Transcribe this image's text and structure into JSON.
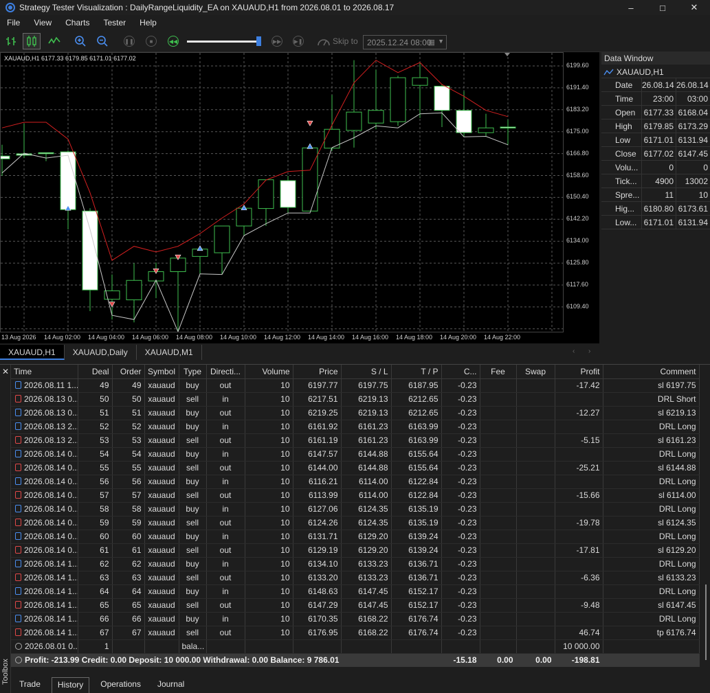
{
  "window": {
    "title": "Strategy Tester Visualization : DailyRangeLiquidity_EA on XAUAUD,H1 from 2026.08.01 to 2026.08.17"
  },
  "menu": [
    "File",
    "View",
    "Charts",
    "Tester",
    "Help"
  ],
  "toolbar": {
    "skip_label": "Skip to",
    "skip_date": "2025.12.24 08:00",
    "speed_fraction": 0.95
  },
  "chart": {
    "info": "XAUAUD,H1  6177.33 6179.85 6171.01 6177.02",
    "price_labels": [
      "6199.60",
      "6191.40",
      "6183.20",
      "6175.00",
      "6166.80",
      "6158.60",
      "6150.40",
      "6142.20",
      "6134.00",
      "6125.80",
      "6117.60",
      "6109.40"
    ],
    "time_labels": [
      "13 Aug 2026",
      "14 Aug 02:00",
      "14 Aug 04:00",
      "14 Aug 06:00",
      "14 Aug 08:00",
      "14 Aug 10:00",
      "14 Aug 12:00",
      "14 Aug 14:00",
      "14 Aug 16:00",
      "14 Aug 18:00",
      "14 Aug 20:00",
      "14 Aug 22:00"
    ],
    "tabs": [
      "XAUAUD,H1",
      "XAUAUD,Daily",
      "XAUAUD,M1"
    ],
    "active_tab": 0
  },
  "chart_data": {
    "type": "candlestick",
    "ylim": [
      6104.2,
      6203.6
    ],
    "candles": [
      {
        "o": 6167.0,
        "h": 6171.0,
        "l": 6160.0,
        "c": 6166.0
      },
      {
        "o": 6167.8,
        "h": 6178.5,
        "l": 6166.3,
        "c": 6167.3
      },
      {
        "o": 6168.2,
        "h": 6168.2,
        "l": 6165.2,
        "c": 6168.0
      },
      {
        "o": 6168.5,
        "h": 6169.0,
        "l": 6141.0,
        "c": 6148.0
      },
      {
        "o": 6147.5,
        "h": 6148.5,
        "l": 6112.0,
        "c": 6119.5
      },
      {
        "o": 6116.2,
        "h": 6125.0,
        "l": 6109.0,
        "c": 6119.2
      },
      {
        "o": 6116.0,
        "h": 6129.0,
        "l": 6108.0,
        "c": 6122.9
      },
      {
        "o": 6122.7,
        "h": 6129.2,
        "l": 6116.6,
        "c": 6126.0
      },
      {
        "o": 6126.0,
        "h": 6131.4,
        "l": 6104.7,
        "c": 6130.8
      },
      {
        "o": 6131.4,
        "h": 6134.2,
        "l": 6125.0,
        "c": 6134.0
      },
      {
        "o": 6132.7,
        "h": 6142.2,
        "l": 6125.0,
        "c": 6142.2
      },
      {
        "o": 6142.2,
        "h": 6148.5,
        "l": 6138.8,
        "c": 6148.5
      },
      {
        "o": 6148.4,
        "h": 6158.6,
        "l": 6142.2,
        "c": 6158.6
      },
      {
        "o": 6158.3,
        "h": 6160.0,
        "l": 6146.8,
        "c": 6148.8
      },
      {
        "o": 6147.5,
        "h": 6170.3,
        "l": 6147.5,
        "c": 6169.9
      },
      {
        "o": 6169.8,
        "h": 6188.7,
        "l": 6168.8,
        "c": 6176.5
      },
      {
        "o": 6176.1,
        "h": 6201.0,
        "l": 6170.0,
        "c": 6182.6
      },
      {
        "o": 6178.7,
        "h": 6197.6,
        "l": 6176.5,
        "c": 6183.2
      },
      {
        "o": 6179.2,
        "h": 6195.5,
        "l": 6177.7,
        "c": 6194.8
      },
      {
        "o": 6192.1,
        "h": 6200.0,
        "l": 6180.5,
        "c": 6194.8
      },
      {
        "o": 6191.8,
        "h": 6192.5,
        "l": 6177.3,
        "c": 6183.2
      },
      {
        "o": 6183.2,
        "h": 6190.0,
        "l": 6173.8,
        "c": 6175.3
      },
      {
        "o": 6175.3,
        "h": 6182.0,
        "l": 6174.0,
        "c": 6177.0
      },
      {
        "o": 6177.3,
        "h": 6179.9,
        "l": 6171.0,
        "c": 6177.0
      }
    ],
    "upper_line": [
      6177.0,
      6179.0,
      6179.0,
      6173.0,
      6154.0,
      6130.0,
      6135.0,
      6133.0,
      6135.0,
      6139.5,
      6145.0,
      6150.0,
      6158.5,
      6161.5,
      6162.0,
      6178.0,
      6193.0,
      6201.0,
      6196.6,
      6200.2,
      6192.4,
      6188.2,
      6183.2,
      6181.0
    ],
    "lower_line": [
      6161.0,
      6168.0,
      6166.3,
      6167.3,
      6141.0,
      6110.5,
      6109.0,
      6123.0,
      6104.7,
      6125.2,
      6125.0,
      6138.8,
      6143.0,
      6146.8,
      6146.8,
      6170.0,
      6173.5,
      6177.7,
      6177.0,
      6182.0,
      6182.3,
      6173.8,
      6174.0,
      6171.0
    ],
    "markers": [
      {
        "i": 3,
        "price": 6148.5,
        "dir": "buy"
      },
      {
        "i": 5,
        "price": 6114.5,
        "dir": "sell"
      },
      {
        "i": 7,
        "price": 6126.3,
        "dir": "sell"
      },
      {
        "i": 8,
        "price": 6131.2,
        "dir": "sell"
      },
      {
        "i": 9,
        "price": 6134.2,
        "dir": "buy"
      },
      {
        "i": 11,
        "price": 6148.6,
        "dir": "buy"
      },
      {
        "i": 14,
        "price": 6178.7,
        "dir": "sell"
      },
      {
        "i": 14,
        "price": 6170.4,
        "dir": "buy"
      }
    ]
  },
  "data_window": {
    "title": "Data Window",
    "symbol": "XAUAUD,H1",
    "rows": [
      {
        "k": "Date",
        "v1": "26.08.14",
        "v2": "26.08.14"
      },
      {
        "k": "Time",
        "v1": "23:00",
        "v2": "03:00"
      },
      {
        "k": "Open",
        "v1": "6177.33",
        "v2": "6168.04"
      },
      {
        "k": "High",
        "v1": "6179.85",
        "v2": "6173.29"
      },
      {
        "k": "Low",
        "v1": "6171.01",
        "v2": "6131.94"
      },
      {
        "k": "Close",
        "v1": "6177.02",
        "v2": "6147.45"
      },
      {
        "k": "Volu...",
        "v1": "0",
        "v2": "0"
      },
      {
        "k": "Tick...",
        "v1": "4900",
        "v2": "13002"
      },
      {
        "k": "Spre...",
        "v1": "11",
        "v2": "10"
      },
      {
        "k": "Hig...",
        "v1": "6180.80",
        "v2": "6173.61"
      },
      {
        "k": "Low...",
        "v1": "6171.01",
        "v2": "6131.94"
      }
    ]
  },
  "deals": {
    "columns": [
      "Time",
      "Deal",
      "Order",
      "Symbol",
      "Type",
      "Directi...",
      "Volume",
      "Price",
      "S / L",
      "T / P",
      "C...",
      "Fee",
      "Swap",
      "Profit",
      "Comment"
    ],
    "rows": [
      {
        "side": "buy",
        "time": "2026.08.11 1...",
        "deal": "49",
        "order": "49",
        "symbol": "xauaud",
        "type": "buy",
        "dir": "out",
        "vol": "10",
        "price": "6197.77",
        "sl": "6197.75",
        "tp": "6187.95",
        "comm": "-0.23",
        "fee": "",
        "swap": "",
        "profit": "-17.42",
        "comment": "sl 6197.75"
      },
      {
        "side": "sell",
        "time": "2026.08.13 0...",
        "deal": "50",
        "order": "50",
        "symbol": "xauaud",
        "type": "sell",
        "dir": "in",
        "vol": "10",
        "price": "6217.51",
        "sl": "6219.13",
        "tp": "6212.65",
        "comm": "-0.23",
        "fee": "",
        "swap": "",
        "profit": "",
        "comment": "DRL Short"
      },
      {
        "side": "buy",
        "time": "2026.08.13 0...",
        "deal": "51",
        "order": "51",
        "symbol": "xauaud",
        "type": "buy",
        "dir": "out",
        "vol": "10",
        "price": "6219.25",
        "sl": "6219.13",
        "tp": "6212.65",
        "comm": "-0.23",
        "fee": "",
        "swap": "",
        "profit": "-12.27",
        "comment": "sl 6219.13"
      },
      {
        "side": "buy",
        "time": "2026.08.13 2...",
        "deal": "52",
        "order": "52",
        "symbol": "xauaud",
        "type": "buy",
        "dir": "in",
        "vol": "10",
        "price": "6161.92",
        "sl": "6161.23",
        "tp": "6163.99",
        "comm": "-0.23",
        "fee": "",
        "swap": "",
        "profit": "",
        "comment": "DRL Long"
      },
      {
        "side": "sell",
        "time": "2026.08.13 2...",
        "deal": "53",
        "order": "53",
        "symbol": "xauaud",
        "type": "sell",
        "dir": "out",
        "vol": "10",
        "price": "6161.19",
        "sl": "6161.23",
        "tp": "6163.99",
        "comm": "-0.23",
        "fee": "",
        "swap": "",
        "profit": "-5.15",
        "comment": "sl 6161.23"
      },
      {
        "side": "buy",
        "time": "2026.08.14 0...",
        "deal": "54",
        "order": "54",
        "symbol": "xauaud",
        "type": "buy",
        "dir": "in",
        "vol": "10",
        "price": "6147.57",
        "sl": "6144.88",
        "tp": "6155.64",
        "comm": "-0.23",
        "fee": "",
        "swap": "",
        "profit": "",
        "comment": "DRL Long"
      },
      {
        "side": "sell",
        "time": "2026.08.14 0...",
        "deal": "55",
        "order": "55",
        "symbol": "xauaud",
        "type": "sell",
        "dir": "out",
        "vol": "10",
        "price": "6144.00",
        "sl": "6144.88",
        "tp": "6155.64",
        "comm": "-0.23",
        "fee": "",
        "swap": "",
        "profit": "-25.21",
        "comment": "sl 6144.88"
      },
      {
        "side": "buy",
        "time": "2026.08.14 0...",
        "deal": "56",
        "order": "56",
        "symbol": "xauaud",
        "type": "buy",
        "dir": "in",
        "vol": "10",
        "price": "6116.21",
        "sl": "6114.00",
        "tp": "6122.84",
        "comm": "-0.23",
        "fee": "",
        "swap": "",
        "profit": "",
        "comment": "DRL Long"
      },
      {
        "side": "sell",
        "time": "2026.08.14 0...",
        "deal": "57",
        "order": "57",
        "symbol": "xauaud",
        "type": "sell",
        "dir": "out",
        "vol": "10",
        "price": "6113.99",
        "sl": "6114.00",
        "tp": "6122.84",
        "comm": "-0.23",
        "fee": "",
        "swap": "",
        "profit": "-15.66",
        "comment": "sl 6114.00"
      },
      {
        "side": "buy",
        "time": "2026.08.14 0...",
        "deal": "58",
        "order": "58",
        "symbol": "xauaud",
        "type": "buy",
        "dir": "in",
        "vol": "10",
        "price": "6127.06",
        "sl": "6124.35",
        "tp": "6135.19",
        "comm": "-0.23",
        "fee": "",
        "swap": "",
        "profit": "",
        "comment": "DRL Long"
      },
      {
        "side": "sell",
        "time": "2026.08.14 0...",
        "deal": "59",
        "order": "59",
        "symbol": "xauaud",
        "type": "sell",
        "dir": "out",
        "vol": "10",
        "price": "6124.26",
        "sl": "6124.35",
        "tp": "6135.19",
        "comm": "-0.23",
        "fee": "",
        "swap": "",
        "profit": "-19.78",
        "comment": "sl 6124.35"
      },
      {
        "side": "buy",
        "time": "2026.08.14 0...",
        "deal": "60",
        "order": "60",
        "symbol": "xauaud",
        "type": "buy",
        "dir": "in",
        "vol": "10",
        "price": "6131.71",
        "sl": "6129.20",
        "tp": "6139.24",
        "comm": "-0.23",
        "fee": "",
        "swap": "",
        "profit": "",
        "comment": "DRL Long"
      },
      {
        "side": "sell",
        "time": "2026.08.14 0...",
        "deal": "61",
        "order": "61",
        "symbol": "xauaud",
        "type": "sell",
        "dir": "out",
        "vol": "10",
        "price": "6129.19",
        "sl": "6129.20",
        "tp": "6139.24",
        "comm": "-0.23",
        "fee": "",
        "swap": "",
        "profit": "-17.81",
        "comment": "sl 6129.20"
      },
      {
        "side": "buy",
        "time": "2026.08.14 1...",
        "deal": "62",
        "order": "62",
        "symbol": "xauaud",
        "type": "buy",
        "dir": "in",
        "vol": "10",
        "price": "6134.10",
        "sl": "6133.23",
        "tp": "6136.71",
        "comm": "-0.23",
        "fee": "",
        "swap": "",
        "profit": "",
        "comment": "DRL Long"
      },
      {
        "side": "sell",
        "time": "2026.08.14 1...",
        "deal": "63",
        "order": "63",
        "symbol": "xauaud",
        "type": "sell",
        "dir": "out",
        "vol": "10",
        "price": "6133.20",
        "sl": "6133.23",
        "tp": "6136.71",
        "comm": "-0.23",
        "fee": "",
        "swap": "",
        "profit": "-6.36",
        "comment": "sl 6133.23"
      },
      {
        "side": "buy",
        "time": "2026.08.14 1...",
        "deal": "64",
        "order": "64",
        "symbol": "xauaud",
        "type": "buy",
        "dir": "in",
        "vol": "10",
        "price": "6148.63",
        "sl": "6147.45",
        "tp": "6152.17",
        "comm": "-0.23",
        "fee": "",
        "swap": "",
        "profit": "",
        "comment": "DRL Long"
      },
      {
        "side": "sell",
        "time": "2026.08.14 1...",
        "deal": "65",
        "order": "65",
        "symbol": "xauaud",
        "type": "sell",
        "dir": "out",
        "vol": "10",
        "price": "6147.29",
        "sl": "6147.45",
        "tp": "6152.17",
        "comm": "-0.23",
        "fee": "",
        "swap": "",
        "profit": "-9.48",
        "comment": "sl 6147.45"
      },
      {
        "side": "buy",
        "time": "2026.08.14 1...",
        "deal": "66",
        "order": "66",
        "symbol": "xauaud",
        "type": "buy",
        "dir": "in",
        "vol": "10",
        "price": "6170.35",
        "sl": "6168.22",
        "tp": "6176.74",
        "comm": "-0.23",
        "fee": "",
        "swap": "",
        "profit": "",
        "comment": "DRL Long"
      },
      {
        "side": "sell",
        "time": "2026.08.14 1...",
        "deal": "67",
        "order": "67",
        "symbol": "xauaud",
        "type": "sell",
        "dir": "out",
        "vol": "10",
        "price": "6176.95",
        "sl": "6168.22",
        "tp": "6176.74",
        "comm": "-0.23",
        "fee": "",
        "swap": "",
        "profit": "46.74",
        "comment": "tp 6176.74"
      },
      {
        "side": "bal",
        "time": "2026.08.01 0...",
        "deal": "1",
        "order": "",
        "symbol": "",
        "type": "bala...",
        "dir": "",
        "vol": "",
        "price": "",
        "sl": "",
        "tp": "",
        "comm": "",
        "fee": "",
        "swap": "",
        "profit": "10 000.00",
        "comment": ""
      }
    ],
    "summary": {
      "text": "Profit: -213.99  Credit: 0.00  Deposit: 10 000.00  Withdrawal: 0.00  Balance: 9 786.01",
      "comm": "-15.18",
      "fee": "0.00",
      "swap": "0.00",
      "profit": "-198.81"
    }
  },
  "toolbox": {
    "label": "Toolbox",
    "tabs": [
      "Trade",
      "History",
      "Operations",
      "Journal"
    ],
    "active_tab": 1
  }
}
